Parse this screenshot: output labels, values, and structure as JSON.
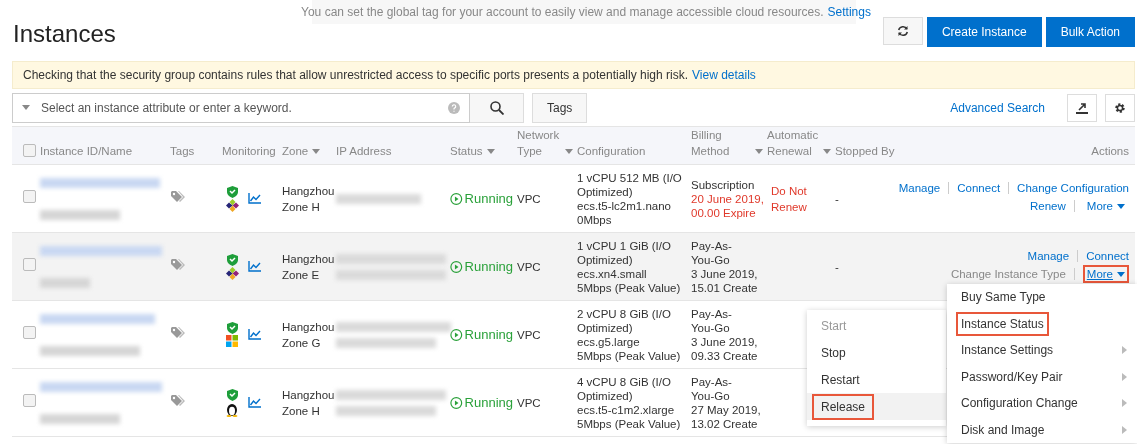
{
  "title": "Instances",
  "notice": {
    "text": "You can set the global tag for your account to easily view and manage accessible cloud resources.",
    "link": "Settings"
  },
  "header_buttons": [
    {
      "label": "Create Instance"
    },
    {
      "label": "Bulk Action"
    }
  ],
  "warning": {
    "text": "Checking that the security group contains rules that allow unrestricted access to specific ports presents a potentially high risk.",
    "link": "View details"
  },
  "search": {
    "placeholder": "Select an instance attribute or enter a keyword."
  },
  "tags_button": "Tags",
  "advanced_search": "Advanced Search",
  "table": {
    "select_all": {
      "checked": false
    },
    "columns": [
      {
        "label": "Instance ID/Name",
        "sortable": false
      },
      {
        "label": "Tags",
        "sortable": false
      },
      {
        "label": "Monitoring",
        "sortable": false
      },
      {
        "label": "Zone",
        "sortable": true
      },
      {
        "label": "IP Address",
        "sortable": false
      },
      {
        "label": "Status",
        "sortable": true
      },
      {
        "label": "Network Type",
        "sortable": true
      },
      {
        "label": "Configuration",
        "sortable": false
      },
      {
        "label": "Billing Method",
        "sortable": true
      },
      {
        "label": "Automatic Renewal",
        "sortable": true
      },
      {
        "label": "Stopped By",
        "sortable": false
      },
      {
        "label": "Actions",
        "sortable": false
      }
    ],
    "rows": [
      {
        "checked": false,
        "hovered": false,
        "kind": "centos",
        "zone": "Hangzhou Zone H",
        "status": "Running",
        "network": "VPC",
        "configuration": [
          "1 vCPU 512 MB (I/O Optimized)",
          "ecs.t5-lc2m1.nano",
          "0Mbps"
        ],
        "billing": {
          "method": "Subscription",
          "date": "20 June 2019, 00.00 Expire",
          "expiring": true
        },
        "renewal": "Do Not Renew",
        "stopped_by": "-",
        "actions": [
          [
            {
              "label": "Manage",
              "disabled": false
            },
            {
              "label": "Connect",
              "disabled": false
            },
            {
              "label": "Change Configuration",
              "disabled": false
            }
          ],
          [
            {
              "label": "Renew",
              "disabled": false
            }
          ]
        ],
        "more": {
          "label": "More",
          "highlighted": false
        }
      },
      {
        "checked": false,
        "hovered": true,
        "kind": "centos",
        "zone": "Hangzhou Zone E",
        "status": "Running",
        "network": "VPC",
        "configuration": [
          "1 vCPU 1 GiB (I/O Optimized)",
          "ecs.xn4.small",
          "5Mbps (Peak Value)"
        ],
        "billing": {
          "method": "Pay-As-You-Go",
          "date": "3 June 2019, 15.01 Create",
          "expiring": false
        },
        "stopped_by": "-",
        "actions": [
          [
            {
              "label": "Manage",
              "disabled": false
            },
            {
              "label": "Connect",
              "disabled": false
            }
          ],
          [
            {
              "label": "Change Instance Type",
              "disabled": true
            }
          ]
        ],
        "more": {
          "label": "More",
          "highlighted": true
        }
      },
      {
        "checked": false,
        "hovered": false,
        "kind": "windows",
        "zone": "Hangzhou Zone G",
        "status": "Running",
        "network": "VPC",
        "configuration": [
          "2 vCPU 8 GiB (I/O Optimized)",
          "ecs.g5.large",
          "5Mbps (Peak Value)"
        ],
        "billing": {
          "method": "Pay-As-You-Go",
          "date": "3 June 2019, 09.33 Create",
          "expiring": false
        }
      },
      {
        "checked": false,
        "hovered": false,
        "kind": "linux",
        "zone": "Hangzhou Zone H",
        "status": "Running",
        "network": "VPC",
        "configuration": [
          "4 vCPU 8 GiB (I/O Optimized)",
          "ecs.t5-c1m2.xlarge",
          "5Mbps (Peak Value)"
        ],
        "billing": {
          "method": "Pay-As-You-Go",
          "date": "27 May 2019, 13.02 Create",
          "expiring": false
        }
      }
    ]
  },
  "more_menu": {
    "items": [
      {
        "label": "Buy Same Type",
        "submenu": false,
        "selected": false
      },
      {
        "label": "Instance Status",
        "submenu": false,
        "selected": true
      },
      {
        "label": "Instance Settings",
        "submenu": true,
        "selected": false
      },
      {
        "label": "Password/Key Pair",
        "submenu": true,
        "selected": false
      },
      {
        "label": "Configuration Change",
        "submenu": true,
        "selected": false
      },
      {
        "label": "Disk and Image",
        "submenu": true,
        "selected": false
      }
    ]
  },
  "status_submenu": {
    "items": [
      {
        "label": "Start",
        "disabled": true,
        "selected": false
      },
      {
        "label": "Stop",
        "disabled": false,
        "selected": false
      },
      {
        "label": "Restart",
        "disabled": false,
        "selected": false
      },
      {
        "label": "Release",
        "disabled": false,
        "selected": true
      }
    ]
  }
}
